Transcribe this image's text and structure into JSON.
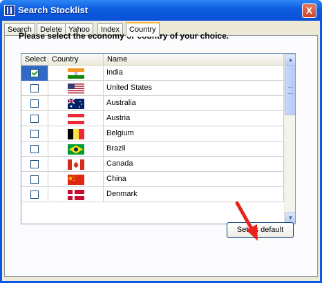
{
  "window": {
    "title": "Search Stocklist",
    "close_glyph": "X"
  },
  "tabs": [
    {
      "label": "Search",
      "active": false
    },
    {
      "label": "Delete",
      "active": false
    },
    {
      "label": "Yahoo",
      "active": false
    },
    {
      "label": "Index",
      "active": false
    },
    {
      "label": "Country",
      "active": true
    }
  ],
  "prompt": "Please select the economy or country of your choice.",
  "grid": {
    "columns": [
      "Select",
      "Country",
      "Name"
    ],
    "rows": [
      {
        "checked": true,
        "flag": "india-flag",
        "name": "India"
      },
      {
        "checked": false,
        "flag": "us-flag",
        "name": "United States"
      },
      {
        "checked": false,
        "flag": "australia-flag",
        "name": "Australia"
      },
      {
        "checked": false,
        "flag": "austria-flag",
        "name": "Austria"
      },
      {
        "checked": false,
        "flag": "belgium-flag",
        "name": "Belgium"
      },
      {
        "checked": false,
        "flag": "brazil-flag",
        "name": "Brazil"
      },
      {
        "checked": false,
        "flag": "canada-flag",
        "name": "Canada"
      },
      {
        "checked": false,
        "flag": "china-flag",
        "name": "China"
      },
      {
        "checked": false,
        "flag": "denmark-flag",
        "name": "Denmark"
      }
    ]
  },
  "default_button": "Set as default",
  "colors": {
    "title_bar": "#0a50d6",
    "selection": "#316ac5",
    "arrow": "#e8241c"
  }
}
